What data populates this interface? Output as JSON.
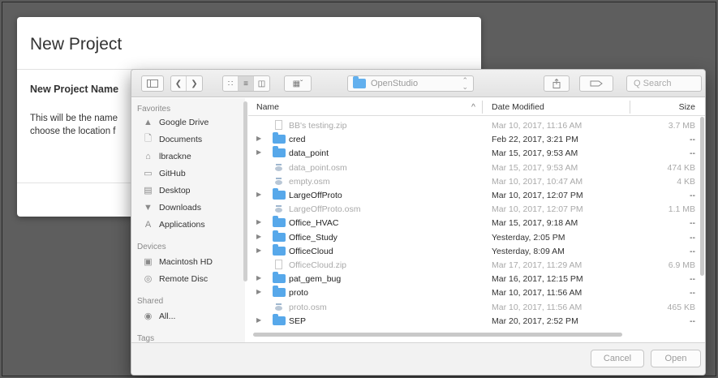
{
  "background_dialog": {
    "title": "New Project",
    "name_label": "New Project Name",
    "description_line1": "This will be the name",
    "description_line2": "choose the location f"
  },
  "finder": {
    "location": "OpenStudio",
    "search_placeholder": "Q Search",
    "columns": {
      "name": "Name",
      "date": "Date Modified",
      "size": "Size",
      "sort_indicator": "^"
    },
    "sidebar": {
      "favorites_header": "Favorites",
      "favorites": [
        {
          "label": "Google Drive",
          "icon": "google-drive-icon"
        },
        {
          "label": "Documents",
          "icon": "documents-icon"
        },
        {
          "label": "lbrackne",
          "icon": "home-icon"
        },
        {
          "label": "GitHub",
          "icon": "folder-icon"
        },
        {
          "label": "Desktop",
          "icon": "desktop-icon"
        },
        {
          "label": "Downloads",
          "icon": "downloads-icon"
        },
        {
          "label": "Applications",
          "icon": "applications-icon"
        }
      ],
      "devices_header": "Devices",
      "devices": [
        {
          "label": "Macintosh HD",
          "icon": "hard-drive-icon"
        },
        {
          "label": "Remote Disc",
          "icon": "disc-icon"
        }
      ],
      "shared_header": "Shared",
      "shared": [
        {
          "label": "All...",
          "icon": "network-icon"
        }
      ],
      "tags_header": "Tags"
    },
    "files": [
      {
        "name": "BB's testing.zip",
        "date": "Mar 10, 2017, 11:16 AM",
        "size": "3.7 MB",
        "kind": "doc",
        "enabled": false
      },
      {
        "name": "cred",
        "date": "Feb 22, 2017, 3:21 PM",
        "size": "--",
        "kind": "folder",
        "enabled": true
      },
      {
        "name": "data_point",
        "date": "Mar 15, 2017, 9:53 AM",
        "size": "--",
        "kind": "folder",
        "enabled": true
      },
      {
        "name": "data_point.osm",
        "date": "Mar 15, 2017, 9:53 AM",
        "size": "474 KB",
        "kind": "osm",
        "enabled": false
      },
      {
        "name": "empty.osm",
        "date": "Mar 10, 2017, 10:47 AM",
        "size": "4 KB",
        "kind": "osm",
        "enabled": false
      },
      {
        "name": "LargeOffProto",
        "date": "Mar 10, 2017, 12:07 PM",
        "size": "--",
        "kind": "folder",
        "enabled": true
      },
      {
        "name": "LargeOffProto.osm",
        "date": "Mar 10, 2017, 12:07 PM",
        "size": "1.1 MB",
        "kind": "osm",
        "enabled": false
      },
      {
        "name": "Office_HVAC",
        "date": "Mar 15, 2017, 9:18 AM",
        "size": "--",
        "kind": "folder",
        "enabled": true
      },
      {
        "name": "Office_Study",
        "date": "Yesterday, 2:05 PM",
        "size": "--",
        "kind": "folder",
        "enabled": true
      },
      {
        "name": "OfficeCloud",
        "date": "Yesterday, 8:09 AM",
        "size": "--",
        "kind": "folder",
        "enabled": true
      },
      {
        "name": "OfficeCloud.zip",
        "date": "Mar 17, 2017, 11:29 AM",
        "size": "6.9 MB",
        "kind": "doc",
        "enabled": false
      },
      {
        "name": "pat_gem_bug",
        "date": "Mar 16, 2017, 12:15 PM",
        "size": "--",
        "kind": "folder",
        "enabled": true
      },
      {
        "name": "proto",
        "date": "Mar 10, 2017, 11:56 AM",
        "size": "--",
        "kind": "folder",
        "enabled": true
      },
      {
        "name": "proto.osm",
        "date": "Mar 10, 2017, 11:56 AM",
        "size": "465 KB",
        "kind": "osm",
        "enabled": false
      },
      {
        "name": "SEP",
        "date": "Mar 20, 2017, 2:52 PM",
        "size": "--",
        "kind": "folder",
        "enabled": true
      }
    ],
    "buttons": {
      "cancel": "Cancel",
      "open": "Open"
    }
  }
}
